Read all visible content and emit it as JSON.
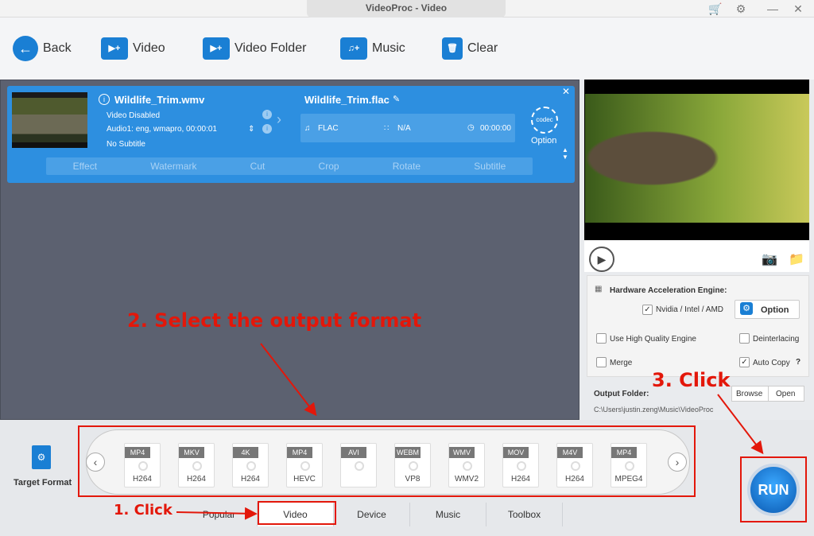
{
  "window": {
    "title": "VideoProc - Video"
  },
  "toolbar": {
    "back": "Back",
    "video": "Video",
    "video_folder": "Video Folder",
    "music": "Music",
    "clear": "Clear"
  },
  "file": {
    "source_name": "Wildlife_Trim.wmv",
    "video_status": "Video Disabled",
    "audio": "Audio1: eng, wmapro, 00:00:01",
    "subtitle": "No Subtitle",
    "output_name": "Wildlife_Trim.flac",
    "out_format": "FLAC",
    "out_res": "N/A",
    "out_duration": "00:00:00",
    "codec_badge": "codec",
    "option_label": "Option"
  },
  "edit_bar": [
    "Effect",
    "Watermark",
    "Cut",
    "Crop",
    "Rotate",
    "Subtitle"
  ],
  "settings": {
    "hw_title": "Hardware Acceleration Engine:",
    "hw_vendor": "Nvidia / Intel / AMD",
    "option_btn": "Option",
    "high_quality": "Use High Quality Engine",
    "deinterlacing": "Deinterlacing",
    "merge": "Merge",
    "auto_copy": "Auto Copy",
    "output_folder_label": "Output Folder:",
    "browse": "Browse",
    "open": "Open",
    "output_path": "C:\\Users\\justin.zeng\\Music\\VideoProc"
  },
  "target_format": "Target Format",
  "formats": [
    {
      "tag": "MP4",
      "sub": "H264"
    },
    {
      "tag": "MKV",
      "sub": "H264"
    },
    {
      "tag": "4K",
      "sub": "H264"
    },
    {
      "tag": "MP4",
      "sub": "HEVC"
    },
    {
      "tag": "AVI",
      "sub": ""
    },
    {
      "tag": "WEBM",
      "sub": "VP8"
    },
    {
      "tag": "WMV",
      "sub": "WMV2"
    },
    {
      "tag": "MOV",
      "sub": "H264"
    },
    {
      "tag": "M4V",
      "sub": "H264"
    },
    {
      "tag": "MP4",
      "sub": "MPEG4"
    }
  ],
  "tabs": [
    "Popular",
    "Video",
    "Device",
    "Music",
    "Toolbox"
  ],
  "run": "RUN",
  "annotations": {
    "step1": "1. Click",
    "step2": "2. Select the output format",
    "step3": "3. Click"
  },
  "colors": {
    "accent": "#2d8fe0",
    "annotation": "#e3170a"
  }
}
